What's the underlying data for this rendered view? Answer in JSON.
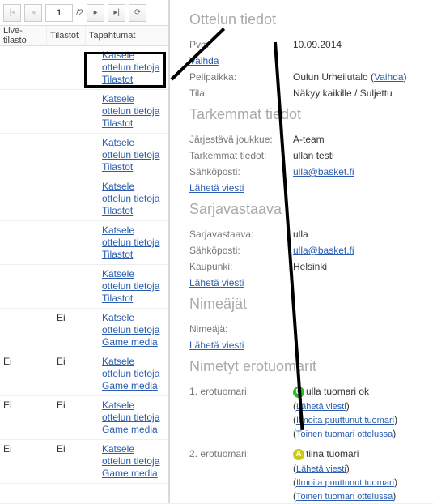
{
  "pager": {
    "first_title": "Ensimmäinen",
    "prev_title": "Edellinen",
    "page_value": "1",
    "total": "/2",
    "next_title": "Seuraava",
    "last_title": "Viimeinen",
    "refresh_title": "Päivitä"
  },
  "columns": {
    "c1": "Live-tilasto",
    "c2": "Tilastot",
    "c3": "Tapahtumat"
  },
  "link_text": {
    "katsele": "Katsele ottelun tietoja",
    "tilastot": "Tilastot",
    "gamemedia": "Game media"
  },
  "status_ei": "Ei",
  "rows": [
    {
      "group": "tilastot"
    },
    {
      "group": "tilastot"
    },
    {
      "group": "tilastot"
    },
    {
      "group": "tilastot"
    },
    {
      "group": "tilastot"
    },
    {
      "group": "tilastot"
    },
    {
      "c2": "Ei",
      "group": "gamemedia"
    },
    {
      "c1": "Ei",
      "c2": "Ei",
      "group": "gamemedia"
    },
    {
      "c1": "Ei",
      "c2": "Ei",
      "group": "gamemedia"
    },
    {
      "c1": "Ei",
      "c2": "Ei",
      "group": "gamemedia"
    }
  ],
  "sections": {
    "ottelun": "Ottelun tiedot",
    "tarkemmat": "Tarkemmat tiedot",
    "sarjavastaava": "Sarjavastaava",
    "nimeajat": "Nimeäjät",
    "nimetyt": "Nimetyt erotuomarit"
  },
  "details": {
    "pvm_label": "Pvm:",
    "pvm_value": "10.09.2014",
    "vaihda": "Vaihda",
    "pelipaikka_label": "Pelipaikka:",
    "pelipaikka_value": "Oulun Urheilutalo",
    "tila_label": "Tila:",
    "tila_value": "Näkyy kaikille / Suljettu",
    "jarjestava_label": "Järjestävä joukkue:",
    "jarjestava_value": "A-team",
    "tark_label": "Tarkemmat tiedot:",
    "tark_value": "ullan testi",
    "sahkoposti_label": "Sähköposti:",
    "sahkoposti_value": "ulla@basket.fi",
    "laheta": "Lähetä viesti",
    "sarjavastaava_label": "Sarjavastaava:",
    "sarjavastaava_value": "ulla",
    "kaupunki_label": "Kaupunki:",
    "kaupunki_value": "Helsinki",
    "nimeaja_label": "Nimeäjä:",
    "ref1_label": "1. erotuomari:",
    "ref1_name": "ulla tuomari ok",
    "ref2_label": "2. erotuomari:",
    "ref2_name": "tiina tuomari",
    "ilmoita": "Ilmoita puuttunut tuomari",
    "toinen": "Toinen tuomari ottelussa"
  }
}
